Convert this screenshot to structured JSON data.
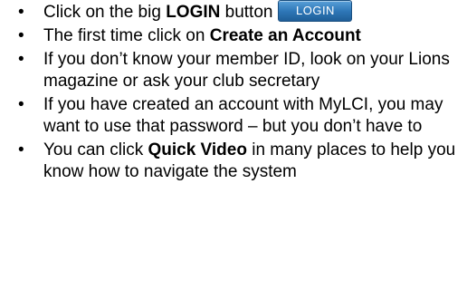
{
  "bullet_glyph": "•",
  "items": [
    {
      "before": "Click on the big ",
      "bold": "LOGIN",
      "after": " button",
      "button_label": "LOGIN"
    },
    {
      "before": "The first time click on ",
      "bold": "Create an Account",
      "after": ""
    },
    {
      "text": "If you don’t know your member ID, look on your Lions magazine or ask your club secretary"
    },
    {
      "text": "If you have created an account with MyLCI, you may want to use that password – but you don’t have to"
    },
    {
      "before": "You can click ",
      "bold": "Quick Video",
      "after": " in many places to help you know how to navigate the system"
    }
  ],
  "colors": {
    "button_top": "#5aa0d8",
    "button_bottom": "#1f5e98",
    "text": "#000000"
  }
}
